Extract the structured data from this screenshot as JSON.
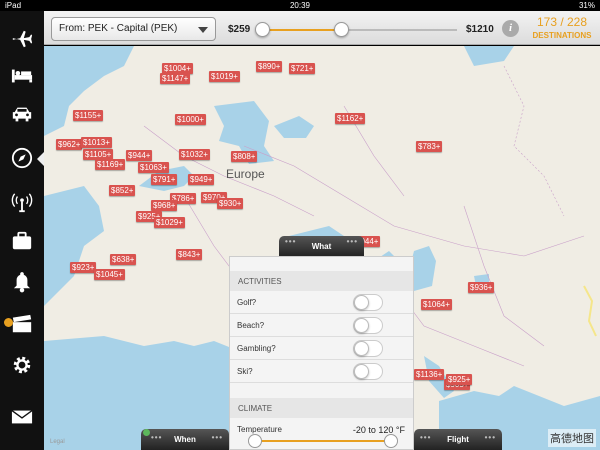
{
  "status": {
    "device": "iPad",
    "time": "20:39",
    "battery": "31%"
  },
  "toolbar": {
    "from_label": "From: PEK - Capital (PEK)",
    "price_min": "$259",
    "price_max": "$1210",
    "info_label": "i",
    "dest_count": "173 / 228",
    "dest_label": "DESTINATIONS",
    "slider_low_fraction": 0.0,
    "slider_high_fraction": 0.17
  },
  "sidebar": {
    "items": [
      {
        "name": "flights",
        "icon": "airplane-icon"
      },
      {
        "name": "hotels",
        "icon": "bed-icon"
      },
      {
        "name": "cars",
        "icon": "car-icon"
      },
      {
        "name": "explore",
        "icon": "compass-icon",
        "active": true
      },
      {
        "name": "airports",
        "icon": "radio-tower-icon"
      },
      {
        "name": "trips",
        "icon": "briefcase-icon"
      },
      {
        "name": "alerts",
        "icon": "bell-icon"
      },
      {
        "name": "deals",
        "icon": "clapperboard-icon",
        "badge": true
      },
      {
        "name": "settings",
        "icon": "gear-icon"
      },
      {
        "name": "messages",
        "icon": "envelope-icon"
      }
    ]
  },
  "map": {
    "region_label": "Europe",
    "watermark": "高德地图",
    "corner": "Legal",
    "prices": [
      "$1004+",
      "$1147+",
      "$1019+",
      "$890+",
      "$721+",
      "$1155+",
      "$1000+",
      "$1162+",
      "$962+",
      "$1013+",
      "$1105+",
      "$944+",
      "$1032+",
      "$808+",
      "$783+",
      "$1169+",
      "$1063+",
      "$791+",
      "$949+",
      "$852+",
      "$786+",
      "$970+",
      "$968+",
      "$930+",
      "$925+",
      "$1029+",
      "$843+",
      "$638+",
      "$923+",
      "$1045+",
      "$936+",
      "$1064+",
      "$1136+",
      "$905+",
      "$925+",
      "$944+"
    ]
  },
  "panel": {
    "activities_header": "ACTIVITIES",
    "activities": [
      {
        "label": "Golf?",
        "on": false
      },
      {
        "label": "Beach?",
        "on": false
      },
      {
        "label": "Gambling?",
        "on": false
      },
      {
        "label": "Ski?",
        "on": false
      }
    ],
    "climate_header": "CLIMATE",
    "temperature_label": "Temperature",
    "temperature_value": "-20 to 120 °F"
  },
  "tabs": {
    "what": "What",
    "when": "When",
    "flight": "Flight"
  },
  "colors": {
    "accent": "#e8a020",
    "price_tag": "#d9534f",
    "sidebar": "#111111"
  }
}
